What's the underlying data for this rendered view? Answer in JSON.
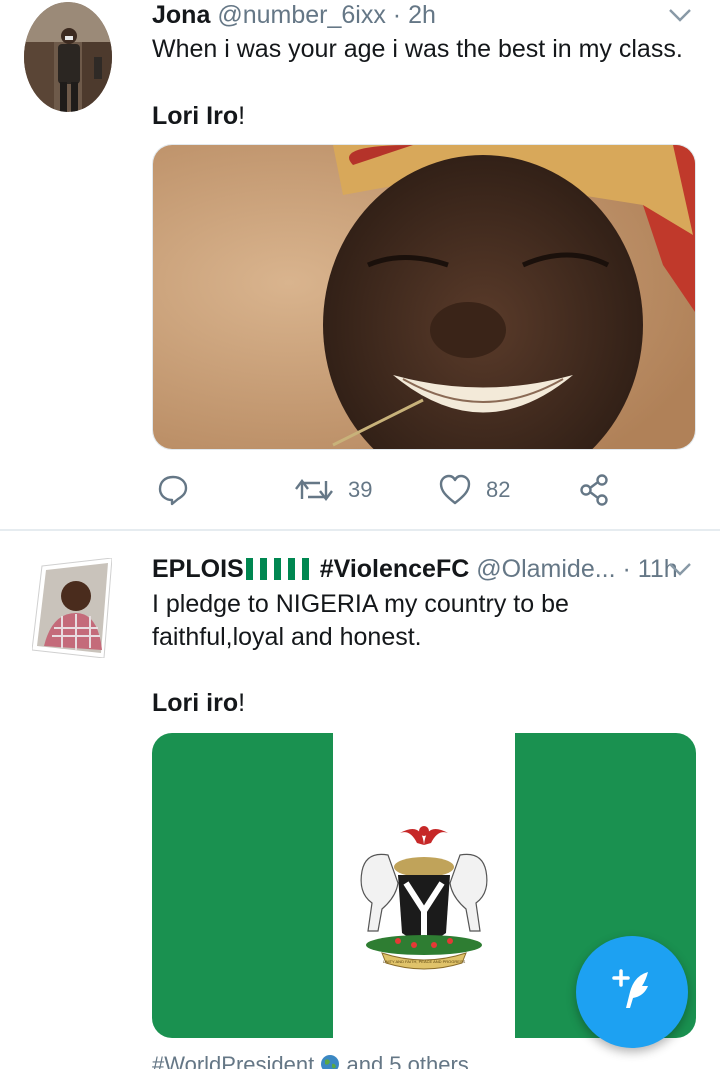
{
  "tweets": [
    {
      "name": "Jona",
      "handle": "@number_6ixx",
      "separator": "·",
      "time": "2h",
      "line1": "When i was your age i was the best in my class.",
      "line2_bold": "Lori Iro",
      "line2_tail": "!",
      "actions": {
        "retweets": "39",
        "likes": "82"
      }
    },
    {
      "name": "EPLOIS",
      "name_suffix": "#ViolenceFC",
      "handle": "@Olamide...",
      "separator": "·",
      "time": "11h",
      "line1": "I pledge to NIGERIA my country to be",
      "line1b": "faithful,loyal and honest.",
      "line2_bold": "Lori iro",
      "line2_tail": "!",
      "footer": "#WorldPresident",
      "footer_tail": "and 5 others",
      "coat_motto": "UNITY AND FAITH, PEACE AND PROGRESS"
    }
  ],
  "colors": {
    "accent": "#1da1f2",
    "muted": "#657786",
    "flag_green": "#008751"
  },
  "icons": [
    "chevron-down-icon",
    "reply-icon",
    "retweet-icon",
    "like-icon",
    "share-icon",
    "compose-icon",
    "globe-icon",
    "flag-icon"
  ]
}
